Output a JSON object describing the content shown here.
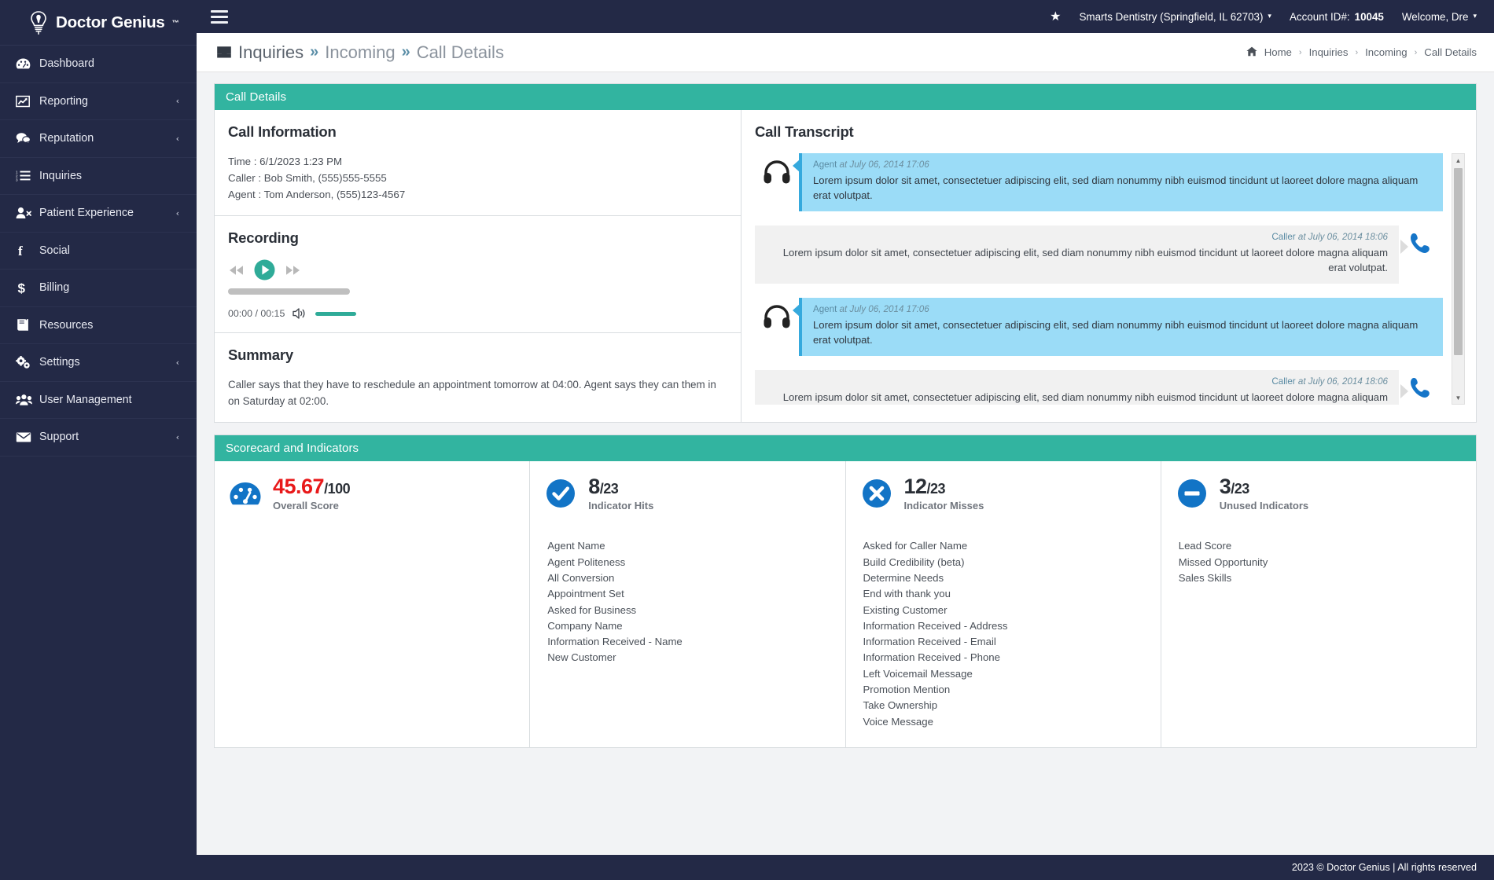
{
  "brand": {
    "name": "Doctor Genius",
    "tm": "™"
  },
  "sidebar": {
    "items": [
      {
        "label": "Dashboard",
        "icon": "dashboard-icon",
        "caret": ""
      },
      {
        "label": "Reporting",
        "icon": "chart-line-icon",
        "caret": "‹"
      },
      {
        "label": "Reputation",
        "icon": "comments-icon",
        "caret": "‹"
      },
      {
        "label": "Inquiries",
        "icon": "list-ol-icon",
        "caret": ""
      },
      {
        "label": "Patient Experience",
        "icon": "user-times-icon",
        "caret": "‹"
      },
      {
        "label": "Social",
        "icon": "facebook-icon",
        "caret": ""
      },
      {
        "label": "Billing",
        "icon": "dollar-icon",
        "caret": ""
      },
      {
        "label": "Resources",
        "icon": "book-icon",
        "caret": ""
      },
      {
        "label": "Settings",
        "icon": "gears-icon",
        "caret": "‹"
      },
      {
        "label": "User Management",
        "icon": "users-icon",
        "caret": ""
      },
      {
        "label": "Support",
        "icon": "envelope-icon",
        "caret": "‹"
      }
    ]
  },
  "topbar": {
    "star_icon": "star-icon",
    "practice": "Smarts Dentistry (Springfield, IL 62703)",
    "account_label": "Account ID#:",
    "account_id": "10045",
    "welcome": "Welcome, Dre",
    "caret": "▾"
  },
  "pagehead": {
    "icon": "inbox-icon",
    "title_main": "Inquiries",
    "sep": "»",
    "title_mid": "Incoming",
    "title_last": "Call Details",
    "breadcrumb": {
      "home_icon": "home-icon",
      "items": [
        "Home",
        "Inquiries",
        "Incoming",
        "Call Details"
      ],
      "sep": "›"
    }
  },
  "call_details": {
    "panel_title": "Call Details",
    "call_information": {
      "heading": "Call Information",
      "lines": [
        "Time : 6/1/2023 1:23 PM",
        "Caller : Bob Smith, (555)555-5555",
        "Agent : Tom Anderson, (555)123-4567"
      ]
    },
    "recording": {
      "heading": "Recording",
      "rewind_icon": "rewind-icon",
      "play_icon": "play-icon",
      "forward_icon": "fast-forward-icon",
      "volume_icon": "volume-up-icon",
      "time": "00:00 / 00:15"
    },
    "summary": {
      "heading": "Summary",
      "text": "Caller says that they have to reschedule an appointment tomorrow at 04:00. Agent says they can them in on Saturday at 02:00."
    },
    "transcript": {
      "heading": "Call Transcript",
      "messages": [
        {
          "side": "agent",
          "icon": "headphones-icon",
          "speaker": "Agent",
          "at": "at July 06, 2014 17:06",
          "text": "Lorem ipsum dolor sit amet, consectetuer adipiscing elit, sed diam nonummy nibh euismod tincidunt ut laoreet dolore magna aliquam erat volutpat."
        },
        {
          "side": "caller",
          "icon": "phone-icon",
          "speaker": "Caller",
          "at": "at July 06, 2014 18:06",
          "text": "Lorem ipsum dolor sit amet, consectetuer adipiscing elit, sed diam nonummy nibh euismod tincidunt ut laoreet dolore magna aliquam erat volutpat."
        },
        {
          "side": "agent",
          "icon": "headphones-icon",
          "speaker": "Agent",
          "at": "at July 06, 2014 17:06",
          "text": "Lorem ipsum dolor sit amet, consectetuer adipiscing elit, sed diam nonummy nibh euismod tincidunt ut laoreet dolore magna aliquam erat volutpat."
        },
        {
          "side": "caller",
          "icon": "phone-icon",
          "speaker": "Caller",
          "at": "at July 06, 2014 18:06",
          "text": "Lorem ipsum dolor sit amet, consectetuer adipiscing elit, sed diam nonummy nibh euismod tincidunt ut laoreet dolore magna aliquam erat volutpat."
        }
      ]
    }
  },
  "scorecard": {
    "panel_title": "Scorecard and Indicators",
    "columns": [
      {
        "icon": "tachometer-icon",
        "value": "45.67",
        "denominator": "/100",
        "label": "Overall Score",
        "value_color": "#e8191a",
        "items": []
      },
      {
        "icon": "check-circle-icon",
        "value": "8",
        "denominator": "/23",
        "label": "Indicator Hits",
        "value_color": "#2a2f36",
        "items": [
          "Agent Name",
          "Agent Politeness",
          "All Conversion",
          "Appointment Set",
          "Asked for Business",
          "Company Name",
          "Information Received - Name",
          "New Customer"
        ]
      },
      {
        "icon": "times-circle-icon",
        "value": "12",
        "denominator": "/23",
        "label": "Indicator Misses",
        "value_color": "#2a2f36",
        "items": [
          "Asked for Caller Name",
          "Build Credibility (beta)",
          "Determine Needs",
          "End with thank you",
          "Existing Customer",
          "Information Received - Address",
          "Information Received - Email",
          "Information Received - Phone",
          "Left Voicemail Message",
          "Promotion Mention",
          "Take Ownership",
          "Voice Message"
        ]
      },
      {
        "icon": "minus-circle-icon",
        "value": "3",
        "denominator": "/23",
        "label": "Unused Indicators",
        "value_color": "#2a2f36",
        "items": [
          "Lead Score",
          "Missed Opportunity",
          "Sales Skills"
        ]
      }
    ]
  },
  "footer": {
    "text": "2023 © Doctor Genius | All rights reserved"
  },
  "colors": {
    "sidebar": "#232946",
    "panel_header": "#32b4a0",
    "agent_bubble": "#9bdcf7",
    "caller_bubble": "#f1f1f1",
    "score_red": "#e8191a",
    "icon_blue": "#1274c6"
  }
}
